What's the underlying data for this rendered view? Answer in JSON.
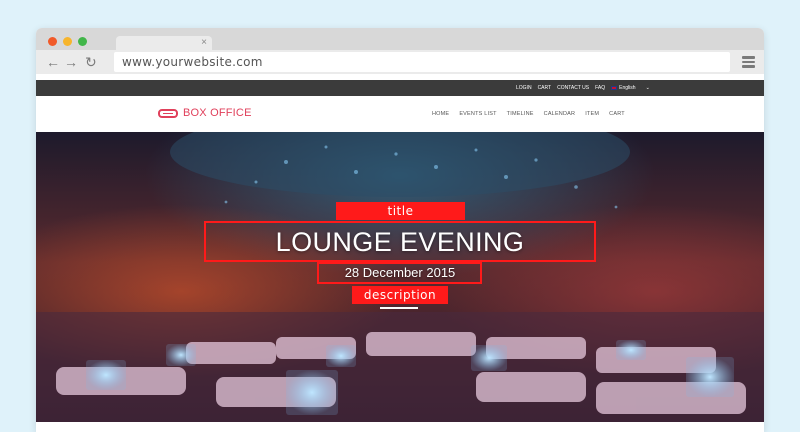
{
  "browser": {
    "url": "www.yourwebsite.com",
    "tab_close_glyph": "×",
    "back_glyph": "←",
    "forward_glyph": "→",
    "reload_glyph": "↻"
  },
  "topbar": {
    "links": [
      "LOGIN",
      "CART",
      "CONTACT US",
      "FAQ"
    ],
    "language": "English",
    "caret": "⌄"
  },
  "site": {
    "logo_text": "BOX OFFICE",
    "menu": [
      "HOME",
      "EVENTS LIST",
      "TIMELINE",
      "CALENDAR",
      "ITEM",
      "CART"
    ]
  },
  "hero": {
    "title": "LOUNGE EVENING",
    "date": "28 December 2015"
  },
  "annotations": {
    "title_label": "title",
    "description_label": "description"
  },
  "colors": {
    "brand": "#e0405b",
    "annotation": "#ff1a1a",
    "topbar": "#3b3b3b",
    "page_background": "#dff2fa"
  },
  "icons": [
    "back-arrow-icon",
    "forward-arrow-icon",
    "reload-icon",
    "hamburger-menu-icon",
    "uk-flag-icon",
    "ticket-logo-icon",
    "close-icon"
  ]
}
